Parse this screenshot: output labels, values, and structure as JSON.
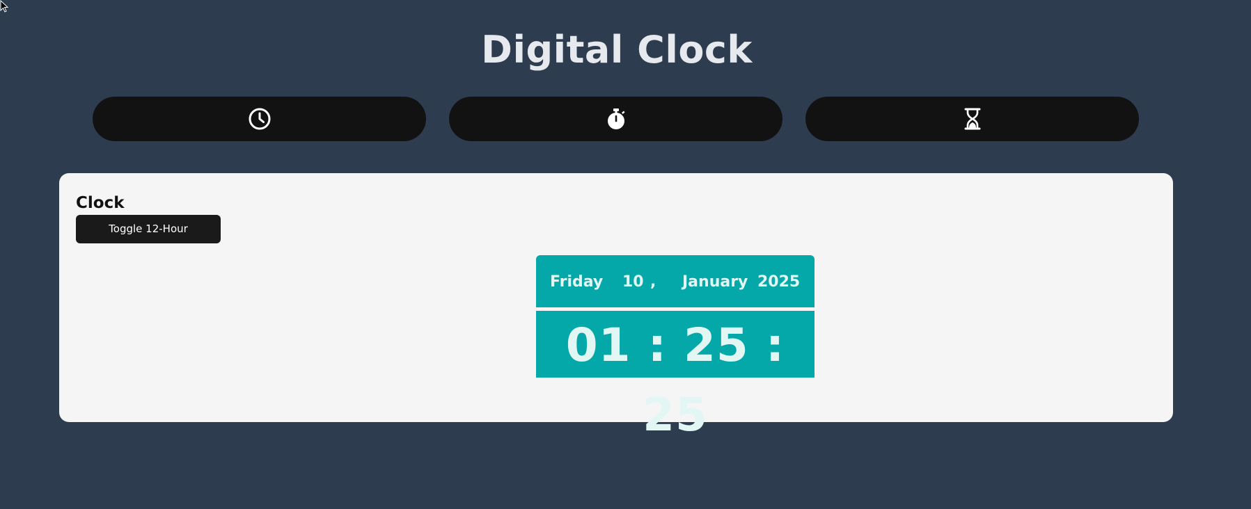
{
  "page": {
    "title": "Digital Clock"
  },
  "tabs": [
    {
      "icon": "clock-icon"
    },
    {
      "icon": "stopwatch-icon"
    },
    {
      "icon": "hourglass-icon"
    }
  ],
  "clock_panel": {
    "heading": "Clock",
    "toggle_label": "Toggle 12-Hour",
    "date": {
      "day": "Friday",
      "date": "10",
      "separator": ",",
      "month": "January",
      "year": "2025"
    },
    "time": {
      "hours": "01",
      "sep1": ":",
      "minutes": "25",
      "sep2": ":",
      "seconds": "25"
    }
  },
  "colors": {
    "background": "#2e3c50",
    "tab_background": "#121212",
    "panel_background": "#f5f5f6",
    "clock_accent": "#04a8a9",
    "clock_text": "#e2f6f4"
  }
}
